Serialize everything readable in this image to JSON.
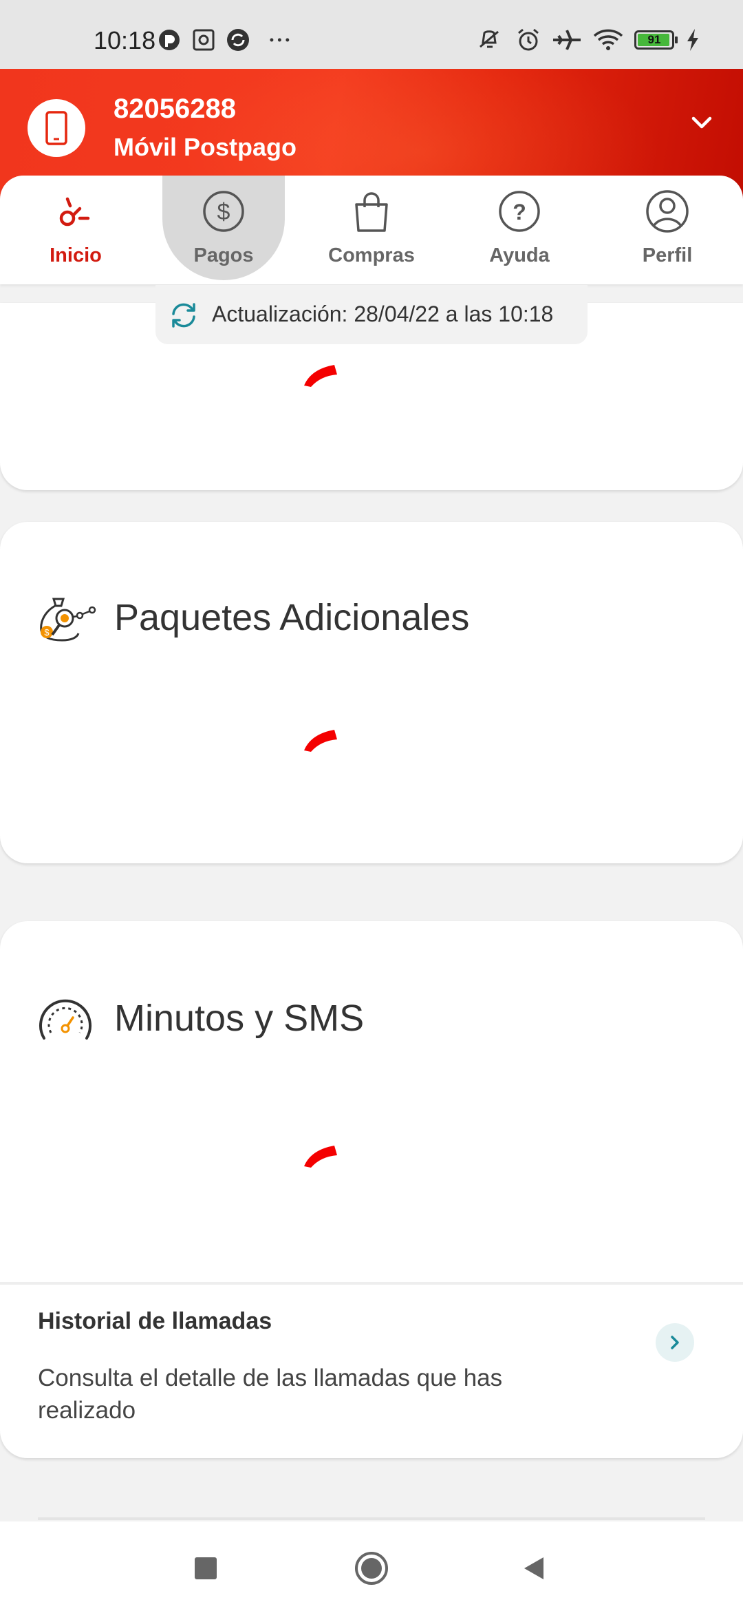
{
  "status_bar": {
    "time": "10:18",
    "battery": "91"
  },
  "header": {
    "line_number": "82056288",
    "plan": "Móvil Postpago"
  },
  "tabs": [
    {
      "label": "Inicio",
      "icon": "home-spark-icon",
      "active": true
    },
    {
      "label": "Pagos",
      "icon": "dollar-icon",
      "active": false
    },
    {
      "label": "Compras",
      "icon": "shopping-bag-icon",
      "active": false
    },
    {
      "label": "Ayuda",
      "icon": "help-icon",
      "active": false
    },
    {
      "label": "Perfil",
      "icon": "profile-icon",
      "active": false
    }
  ],
  "update": {
    "text": "Actualización: 28/04/22 a las 10:18"
  },
  "cards": {
    "paquetes": {
      "title": "Paquetes Adicionales",
      "icon": "money-bag-icon"
    },
    "minutos": {
      "title": "Minutos y SMS",
      "icon": "gauge-icon"
    }
  },
  "history": {
    "title": "Historial de llamadas",
    "description": "Consulta el detalle de las llamadas que has realizado"
  },
  "colors": {
    "brand_red": "#e5270f",
    "active_tab": "#d21b10",
    "teal_accent": "#1a8a99"
  }
}
